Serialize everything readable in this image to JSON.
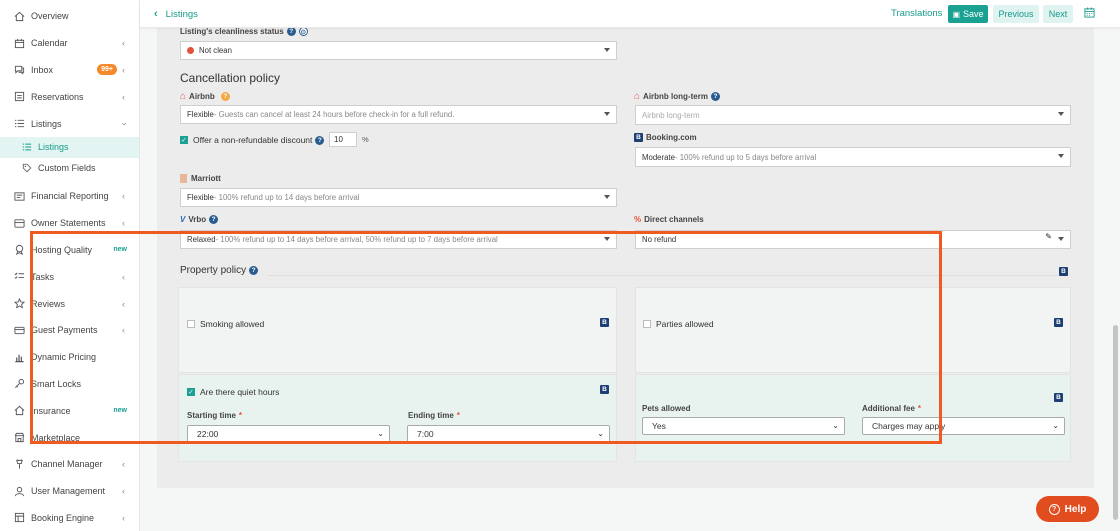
{
  "sidebar": {
    "items": [
      {
        "label": "Overview"
      },
      {
        "label": "Calendar"
      },
      {
        "label": "Inbox",
        "badge": "99+"
      },
      {
        "label": "Reservations"
      },
      {
        "label": "Listings"
      },
      {
        "label": "Listings"
      },
      {
        "label": "Custom Fields"
      },
      {
        "label": "Financial Reporting"
      },
      {
        "label": "Owner Statements"
      },
      {
        "label": "Hosting Quality",
        "badge": "new"
      },
      {
        "label": "Tasks"
      },
      {
        "label": "Reviews"
      },
      {
        "label": "Guest Payments"
      },
      {
        "label": "Dynamic Pricing"
      },
      {
        "label": "Smart Locks"
      },
      {
        "label": "Insurance",
        "badge": "new"
      },
      {
        "label": "Marketplace"
      },
      {
        "label": "Channel Manager"
      },
      {
        "label": "User Management"
      },
      {
        "label": "Booking Engine"
      }
    ]
  },
  "topbar": {
    "back_label": "Listings",
    "translations": "Translations",
    "save": "Save",
    "previous": "Previous",
    "next": "Next"
  },
  "cleanliness": {
    "label": "Listing's cleanliness status",
    "value": "Not clean"
  },
  "cancellation": {
    "title": "Cancellation policy",
    "airbnb_label": "Airbnb",
    "airbnb_value": "Flexible",
    "airbnb_desc": " - Guests can cancel at least 24 hours before check-in for a full refund.",
    "airbnb_lt_label": "Airbnb long-term",
    "airbnb_lt_placeholder": "Airbnb long-term",
    "nonrefundable_label": "Offer a non-refundable discount",
    "nonrefundable_value": "10",
    "percent": "%",
    "booking_label": "Booking.com",
    "booking_value": "Moderate",
    "booking_desc": " - 100% refund up to 5 days before arrival",
    "marriott_label": "Marriott",
    "marriott_value": "Flexible",
    "marriott_desc": " - 100% refund up to 14 days before arrival",
    "vrbo_label": "Vrbo",
    "vrbo_value": "Relaxed",
    "vrbo_desc": " - 100% refund up to 14 days before arrival, 50% refund up to 7 days before arrival",
    "direct_label": "Direct channels",
    "direct_value": "No refund"
  },
  "property_policy": {
    "title": "Property policy",
    "smoking_label": "Smoking allowed",
    "parties_label": "Parties allowed",
    "quiet_hours_label": "Are there quiet hours",
    "starting_time_label": "Starting time",
    "starting_time_value": "22:00",
    "ending_time_label": "Ending time",
    "ending_time_value": "7:00",
    "pets_label": "Pets allowed",
    "pets_value": "Yes",
    "fee_label": "Additional fee",
    "fee_value": "Charges may apply",
    "required_mark": "*",
    "channel_badge": "B"
  },
  "help": {
    "label": "Help"
  },
  "colors": {
    "accent": "#1aa192",
    "highlight": "#ee5a1f",
    "help": "#e24d20"
  }
}
